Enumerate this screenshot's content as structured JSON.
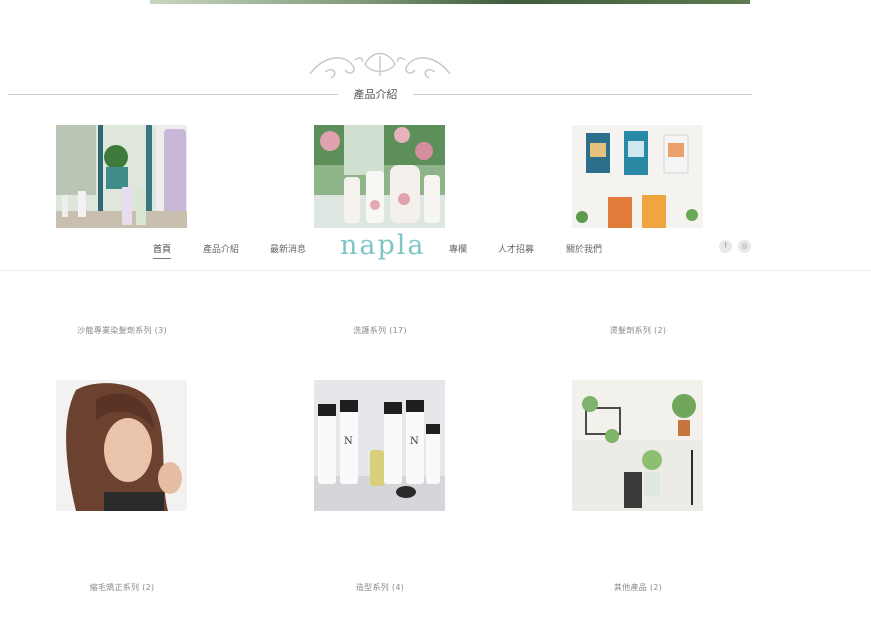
{
  "section": {
    "title": "產品介紹"
  },
  "nav": {
    "items": [
      "首頁",
      "產品介紹",
      "最新消息",
      "專欄",
      "人才招募",
      "關於我們"
    ],
    "logo": "napla",
    "social": [
      "f",
      "◎"
    ]
  },
  "products": [
    {
      "caption": "沙龍專業染髮劑系列 (3)"
    },
    {
      "caption": "洗護系列 (17)"
    },
    {
      "caption": "燙髮劑系列 (2)"
    },
    {
      "caption": "縮毛矯正系列 (2)"
    },
    {
      "caption": "造型系列 (4)"
    },
    {
      "caption": "其他產品 (2)"
    }
  ],
  "colors": {
    "accent": "#7dc6c4",
    "line": "#cfcfcf"
  }
}
